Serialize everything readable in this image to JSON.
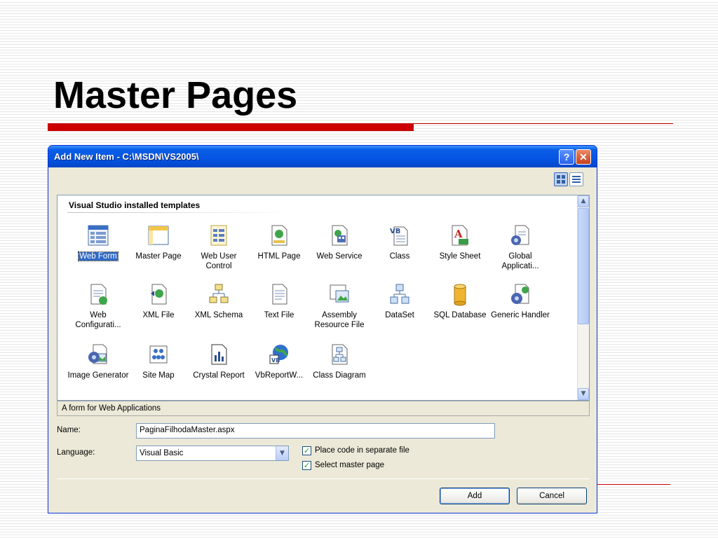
{
  "slide": {
    "title": "Master Pages"
  },
  "dialog": {
    "title": "Add New Item - C:\\MSDN\\VS2005\\",
    "help_glyph": "?",
    "close_glyph": "✕",
    "group_label": "Visual Studio installed templates",
    "templates": [
      {
        "label": "Web Form",
        "icon": "web-form-icon",
        "selected": true
      },
      {
        "label": "Master Page",
        "icon": "master-page-icon"
      },
      {
        "label": "Web User Control",
        "icon": "web-user-control-icon"
      },
      {
        "label": "HTML Page",
        "icon": "html-page-icon"
      },
      {
        "label": "Web Service",
        "icon": "web-service-icon"
      },
      {
        "label": "Class",
        "icon": "class-icon"
      },
      {
        "label": "Style Sheet",
        "icon": "style-sheet-icon"
      },
      {
        "label": "Global Applicati...",
        "icon": "global-application-icon"
      },
      {
        "label": "Web Configurati...",
        "icon": "web-configuration-icon"
      },
      {
        "label": "XML File",
        "icon": "xml-file-icon"
      },
      {
        "label": "XML Schema",
        "icon": "xml-schema-icon"
      },
      {
        "label": "Text File",
        "icon": "text-file-icon"
      },
      {
        "label": "Assembly Resource File",
        "icon": "assembly-resource-file-icon"
      },
      {
        "label": "DataSet",
        "icon": "dataset-icon"
      },
      {
        "label": "SQL Database",
        "icon": "sql-database-icon"
      },
      {
        "label": "Generic Handler",
        "icon": "generic-handler-icon"
      },
      {
        "label": "Image Generator",
        "icon": "image-generator-icon"
      },
      {
        "label": "Site Map",
        "icon": "site-map-icon"
      },
      {
        "label": "Crystal Report",
        "icon": "crystal-report-icon"
      },
      {
        "label": "VbReportW...",
        "icon": "report-wizard-icon"
      },
      {
        "label": "Class Diagram",
        "icon": "class-diagram-icon"
      }
    ],
    "description": "A form for Web Applications",
    "name_label": "Name:",
    "name_value": "PaginaFilhodaMaster.aspx",
    "language_label": "Language:",
    "language_value": "Visual Basic",
    "options": [
      {
        "label": "Place code in separate file",
        "checked": true
      },
      {
        "label": "Select master page",
        "checked": true
      }
    ],
    "add_label": "Add",
    "cancel_label": "Cancel"
  },
  "colors": {
    "title_accent": "#cc0000",
    "titlebar": "#0554e3",
    "selection": "#316ac5",
    "dialog_face": "#ece9d8"
  }
}
